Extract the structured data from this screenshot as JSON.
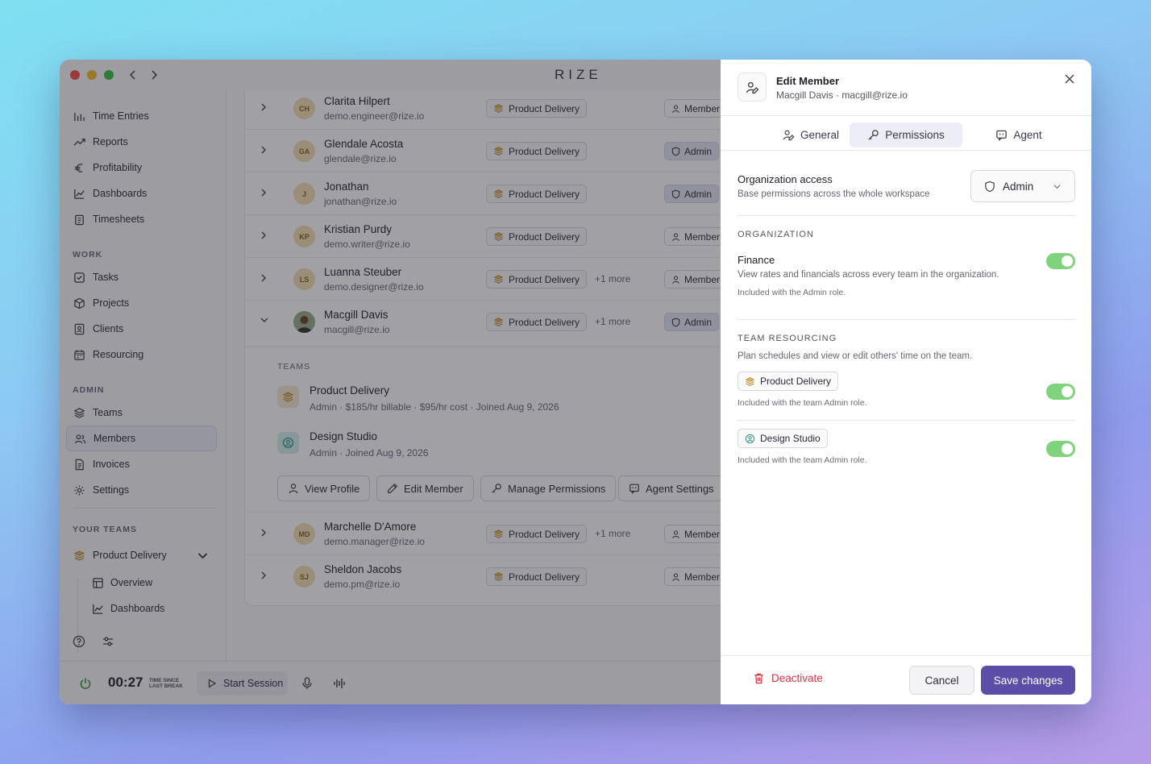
{
  "app": {
    "brand": "RIZE"
  },
  "colors": {
    "accent": "#5c4ea8",
    "toggle_on": "#7ed37c",
    "danger": "#d8343f"
  },
  "sidebar": {
    "items": [
      {
        "label": "Time Entries",
        "icon": "clock-list-icon"
      },
      {
        "label": "Reports",
        "icon": "trend-icon"
      },
      {
        "label": "Profitability",
        "icon": "euro-icon"
      },
      {
        "label": "Dashboards",
        "icon": "chart-icon"
      },
      {
        "label": "Timesheets",
        "icon": "clipboard-icon"
      }
    ],
    "work_heading": "WORK",
    "work_items": [
      {
        "label": "Tasks",
        "icon": "checkbox-icon"
      },
      {
        "label": "Projects",
        "icon": "box-icon"
      },
      {
        "label": "Clients",
        "icon": "contact-icon"
      },
      {
        "label": "Resourcing",
        "icon": "calendar-icon"
      }
    ],
    "admin_heading": "ADMIN",
    "admin_items": [
      {
        "label": "Teams",
        "icon": "layers-icon"
      },
      {
        "label": "Members",
        "icon": "users-icon",
        "active": true
      },
      {
        "label": "Invoices",
        "icon": "invoice-icon"
      },
      {
        "label": "Settings",
        "icon": "gear-icon"
      }
    ],
    "your_teams_heading": "YOUR TEAMS",
    "team": {
      "label": "Product Delivery"
    },
    "team_sub": [
      {
        "label": "Overview"
      },
      {
        "label": "Dashboards"
      }
    ]
  },
  "members": {
    "rows": [
      {
        "initials": "CH",
        "name": "Clarita Hilpert",
        "email": "demo.engineer@rize.io",
        "team": "Product Delivery",
        "more": "",
        "role": "Member"
      },
      {
        "initials": "GA",
        "name": "Glendale Acosta",
        "email": "glendale@rize.io",
        "team": "Product Delivery",
        "more": "",
        "role": "Admin"
      },
      {
        "initials": "J",
        "name": "Jonathan",
        "email": "jonathan@rize.io",
        "team": "Product Delivery",
        "more": "",
        "role": "Admin"
      },
      {
        "initials": "KP",
        "name": "Kristian Purdy",
        "email": "demo.writer@rize.io",
        "team": "Product Delivery",
        "more": "",
        "role": "Member"
      },
      {
        "initials": "LS",
        "name": "Luanna Steuber",
        "email": "demo.designer@rize.io",
        "team": "Product Delivery",
        "more": "+1 more",
        "role": "Member"
      },
      {
        "initials": "",
        "name": "Macgill Davis",
        "email": "macgill@rize.io",
        "team": "Product Delivery",
        "more": "+1 more",
        "role": "Admin"
      },
      {
        "initials": "MD",
        "name": "Marchelle D'Amore",
        "email": "demo.manager@rize.io",
        "team": "Product Delivery",
        "more": "+1 more",
        "role": "Member"
      },
      {
        "initials": "SJ",
        "name": "Sheldon Jacobs",
        "email": "demo.pm@rize.io",
        "team": "Product Delivery",
        "more": "",
        "role": "Member"
      }
    ],
    "expanded": {
      "teams_heading": "TEAMS",
      "teams": [
        {
          "name": "Product Delivery",
          "meta": "Admin · $185/hr billable · $95/hr cost · Joined Aug 9, 2026"
        },
        {
          "name": "Design Studio",
          "meta": "Admin · Joined Aug 9, 2026"
        }
      ],
      "actions": [
        "View Profile",
        "Edit Member",
        "Manage Permissions",
        "Agent Settings"
      ]
    }
  },
  "bottombar": {
    "timer": "00:27",
    "timer_caption_1": "TIME SINCE",
    "timer_caption_2": "LAST BREAK",
    "start_session": "Start Session"
  },
  "panel": {
    "title": "Edit Member",
    "subtitle": "Macgill Davis · macgill@rize.io",
    "tabs": [
      {
        "label": "General",
        "active": false
      },
      {
        "label": "Permissions",
        "active": true
      },
      {
        "label": "Agent",
        "active": false
      }
    ],
    "org_access": {
      "label": "Organization access",
      "desc": "Base permissions across the whole workspace",
      "value": "Admin"
    },
    "organization_heading": "ORGANIZATION",
    "finance": {
      "label": "Finance",
      "desc": "View rates and financials across every team in the organization.",
      "note": "Included with the Admin role.",
      "on": true
    },
    "team_resourcing": {
      "heading": "TEAM RESOURCING",
      "desc": "Plan schedules and view or edit others' time on the team.",
      "teams": [
        {
          "name": "Product Delivery",
          "note": "Included with the team Admin role.",
          "on": true
        },
        {
          "name": "Design Studio",
          "note": "Included with the team Admin role.",
          "on": true
        }
      ]
    },
    "footer": {
      "deactivate": "Deactivate",
      "cancel": "Cancel",
      "save": "Save changes"
    }
  }
}
